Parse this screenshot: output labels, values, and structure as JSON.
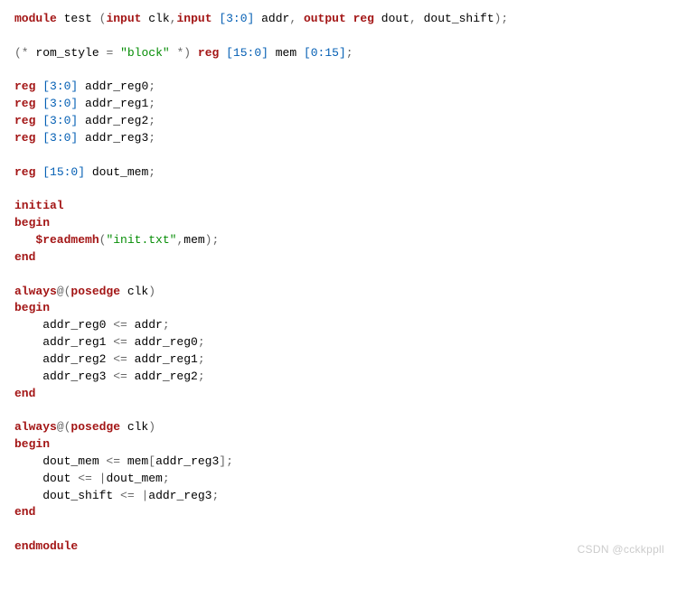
{
  "code": {
    "l1_module": "module",
    "l1_test": " test ",
    "l1_p1": "(",
    "l1_input1": "input",
    "l1_clk": " clk",
    "l1_comma1": ",",
    "l1_input2": "input",
    "l1_sp1": " ",
    "l1_idx1": "[3:0]",
    "l1_addr": " addr",
    "l1_comma2": ", ",
    "l1_output": "output",
    "l1_sp2": " ",
    "l1_reg": "reg",
    "l1_dout": " dout",
    "l1_comma3": ", ",
    "l1_doutshift": "dout_shift",
    "l1_p2": ");",
    "l3_p1": "(*",
    "l3_romstyle": " rom_style ",
    "l3_eq": "=",
    "l3_sp": " ",
    "l3_str": "\"block\"",
    "l3_sp2": " ",
    "l3_p2": "*)",
    "l3_sp3": " ",
    "l3_reg": "reg",
    "l3_sp4": " ",
    "l3_idx1": "[15:0]",
    "l3_mem": " mem ",
    "l3_idx2": "[0:15]",
    "l3_semi": ";",
    "l5_reg": "reg",
    "l5_sp": " ",
    "l5_idx": "[3:0]",
    "l5_ar0": " addr_reg0",
    "l5_semi": ";",
    "l6_reg": "reg",
    "l6_sp": " ",
    "l6_idx": "[3:0]",
    "l6_ar1": " addr_reg1",
    "l6_semi": ";",
    "l7_reg": "reg",
    "l7_sp": " ",
    "l7_idx": "[3:0]",
    "l7_ar2": " addr_reg2",
    "l7_semi": ";",
    "l8_reg": "reg",
    "l8_sp": " ",
    "l8_idx": "[3:0]",
    "l8_ar3": " addr_reg3",
    "l8_semi": ";",
    "l10_reg": "reg",
    "l10_sp": " ",
    "l10_idx": "[15:0]",
    "l10_dm": " dout_mem",
    "l10_semi": ";",
    "l12_initial": "initial",
    "l13_begin": "begin",
    "l14_ind": "   ",
    "l14_readmemh": "$readmemh",
    "l14_p1": "(",
    "l14_str": "\"init.txt\"",
    "l14_comma": ",",
    "l14_mem": "mem",
    "l14_p2": ");",
    "l15_end": "end",
    "l17_always": "always",
    "l17_at": "@(",
    "l17_posedge": "posedge",
    "l17_clk": " clk",
    "l17_p2": ")",
    "l18_begin": "begin",
    "l19": "    addr_reg0 ",
    "l19_op": "<=",
    "l19b": " addr",
    "l19_semi": ";",
    "l20": "    addr_reg1 ",
    "l20_op": "<=",
    "l20b": " addr_reg0",
    "l20_semi": ";",
    "l21": "    addr_reg2 ",
    "l21_op": "<=",
    "l21b": " addr_reg1",
    "l21_semi": ";",
    "l22": "    addr_reg3 ",
    "l22_op": "<=",
    "l22b": " addr_reg2",
    "l22_semi": ";",
    "l23_end": "end",
    "l25_always": "always",
    "l25_at": "@(",
    "l25_posedge": "posedge",
    "l25_clk": " clk",
    "l25_p2": ")",
    "l26_begin": "begin",
    "l27": "    dout_mem ",
    "l27_op": "<=",
    "l27b": " mem",
    "l27_br1": "[",
    "l27c": "addr_reg3",
    "l27_br2": "];",
    "l28": "    dout ",
    "l28_op": "<=",
    "l28b": " ",
    "l28_pipe": "|",
    "l28c": "dout_mem",
    "l28_semi": ";",
    "l29": "    dout_shift ",
    "l29_op": "<=",
    "l29b": " ",
    "l29_pipe": "|",
    "l29c": "addr_reg3",
    "l29_semi": ";",
    "l30_end": "end",
    "l32_endmodule": "endmodule"
  },
  "watermark": "CSDN @cckkppll"
}
